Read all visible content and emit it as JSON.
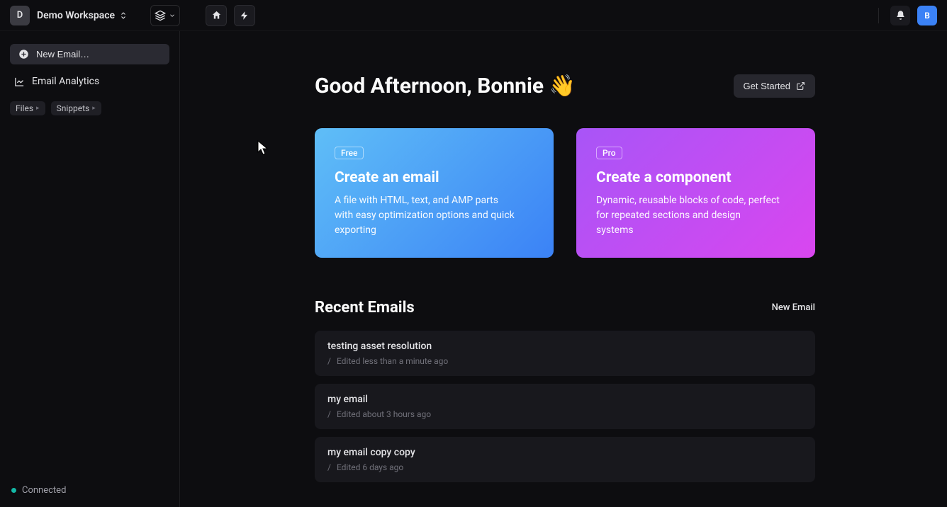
{
  "topbar": {
    "workspace_initial": "D",
    "workspace_name": "Demo Workspace",
    "avatar_initial": "B"
  },
  "sidebar": {
    "new_email_label": "New Email…",
    "analytics_label": "Email Analytics",
    "tags": [
      "Files",
      "Snippets"
    ],
    "connected_label": "Connected"
  },
  "main": {
    "greeting": "Good Afternoon, Bonnie 👋",
    "get_started_label": "Get Started",
    "cards": [
      {
        "badge": "Free",
        "title": "Create an email",
        "desc": "A file with HTML, text, and AMP parts with easy optimization options and quick exporting"
      },
      {
        "badge": "Pro",
        "title": "Create a component",
        "desc": "Dynamic, reusable blocks of code, perfect for repeated sections and design systems"
      }
    ],
    "recent_title": "Recent Emails",
    "new_email_link": "New Email",
    "emails": [
      {
        "title": "testing asset resolution",
        "meta": "Edited less than a minute ago"
      },
      {
        "title": "my email",
        "meta": "Edited about 3 hours ago"
      },
      {
        "title": "my email copy copy",
        "meta": "Edited 6 days ago"
      }
    ]
  }
}
